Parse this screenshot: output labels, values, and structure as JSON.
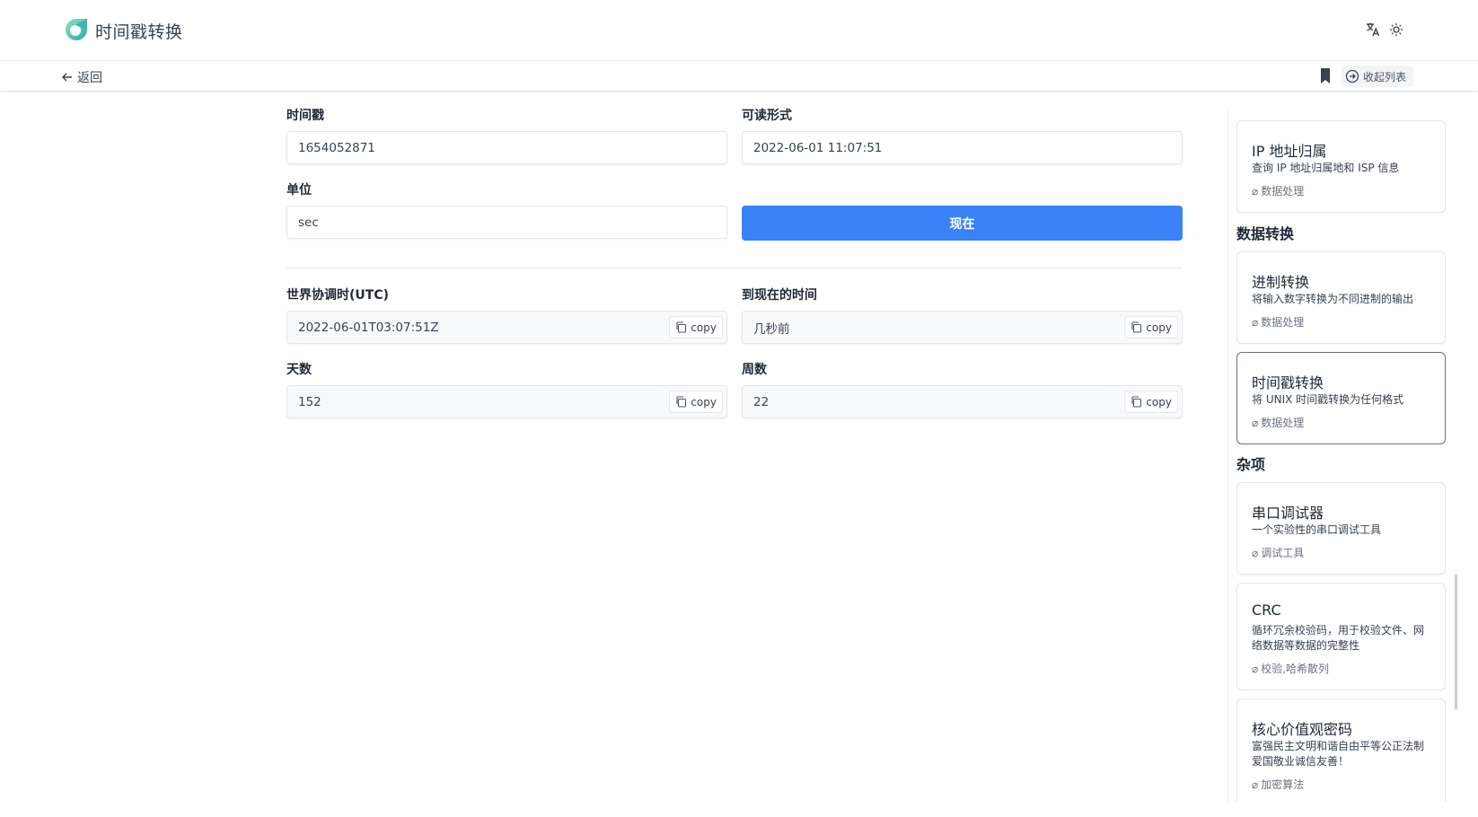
{
  "header": {
    "title": "时间戳转换",
    "translate_icon": "translate-icon",
    "theme_icon": "sun-icon",
    "brand_color": "#4fc4a0"
  },
  "subbar": {
    "back_label": "返回",
    "bookmark_icon": "bookmark-icon",
    "fav_list_label": "收起列表"
  },
  "form": {
    "timestamp_label": "时间戳",
    "timestamp_value": "1654052871",
    "readable_label": "可读形式",
    "readable_value": "2022-06-01 11:07:51",
    "unit_label": "单位",
    "unit_value": "sec",
    "now_button": "现在",
    "accent_color": "#3b82f6"
  },
  "results": {
    "copy_label": "copy",
    "utc_label": "世界协调时(UTC)",
    "utc_value": "2022-06-01T03:07:51Z",
    "since_label": "到现在的时间",
    "since_value": "几秒前",
    "days_label": "天数",
    "days_value": "152",
    "weeks_label": "周数",
    "weeks_value": "22"
  },
  "sidebar": {
    "top_card": {
      "title": "IP 地址归属",
      "desc": "查询 IP 地址归属地和 ISP 信息",
      "tag": "数据处理"
    },
    "sections": [
      {
        "heading": "数据转换",
        "cards": [
          {
            "title": "进制转换",
            "desc": "将输入数字转换为不同进制的输出",
            "tag": "数据处理"
          },
          {
            "title": "时间戳转换",
            "desc": "将 UNIX 时间戳转换为任何格式",
            "tag": "数据处理"
          }
        ]
      },
      {
        "heading": "杂项",
        "cards": [
          {
            "title": "串口调试器",
            "desc": "一个实验性的串口调试工具",
            "tag": "调试工具"
          },
          {
            "title": "CRC",
            "desc": "循环冗余校验码，用于校验文件、网络数据等数据的完整性",
            "tag": "校验,哈希散列"
          },
          {
            "title": "核心价值观密码",
            "desc": "富强民主文明和谐自由平等公正法制爱国敬业诚信友善！",
            "tag": "加密算法"
          }
        ]
      }
    ]
  }
}
